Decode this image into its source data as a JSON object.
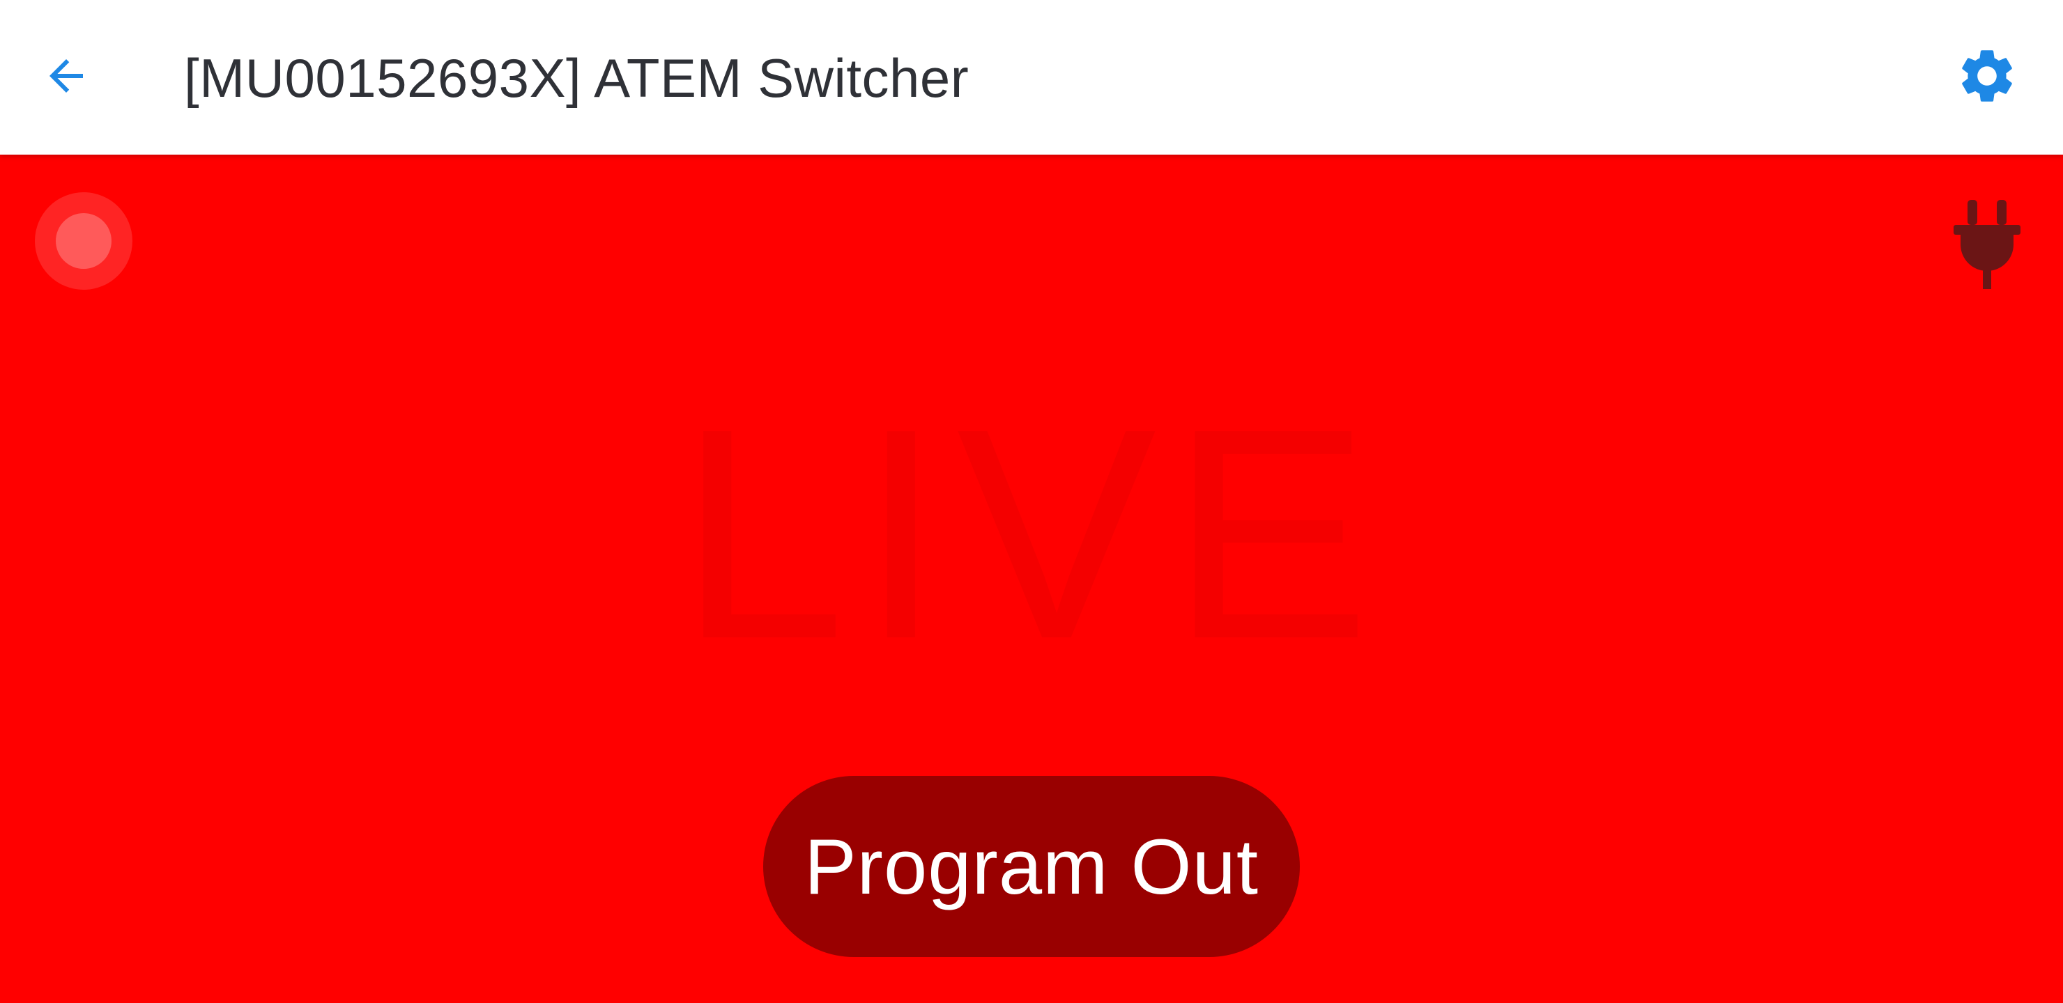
{
  "app_bar": {
    "back_icon": "arrow-left-icon",
    "title": "[MU00152693X] ATEM Switcher",
    "settings_icon": "gear-icon"
  },
  "tally": {
    "background_color": "#ff0000",
    "watermark": "LIVE",
    "source_label": "Program Out",
    "record_icon": "record-dot-icon",
    "connection_icon": "plug-icon"
  },
  "colors": {
    "accent": "#1e88e5",
    "tally_red": "#ff0000",
    "pill": "#990000",
    "plug": "#6b1515"
  }
}
